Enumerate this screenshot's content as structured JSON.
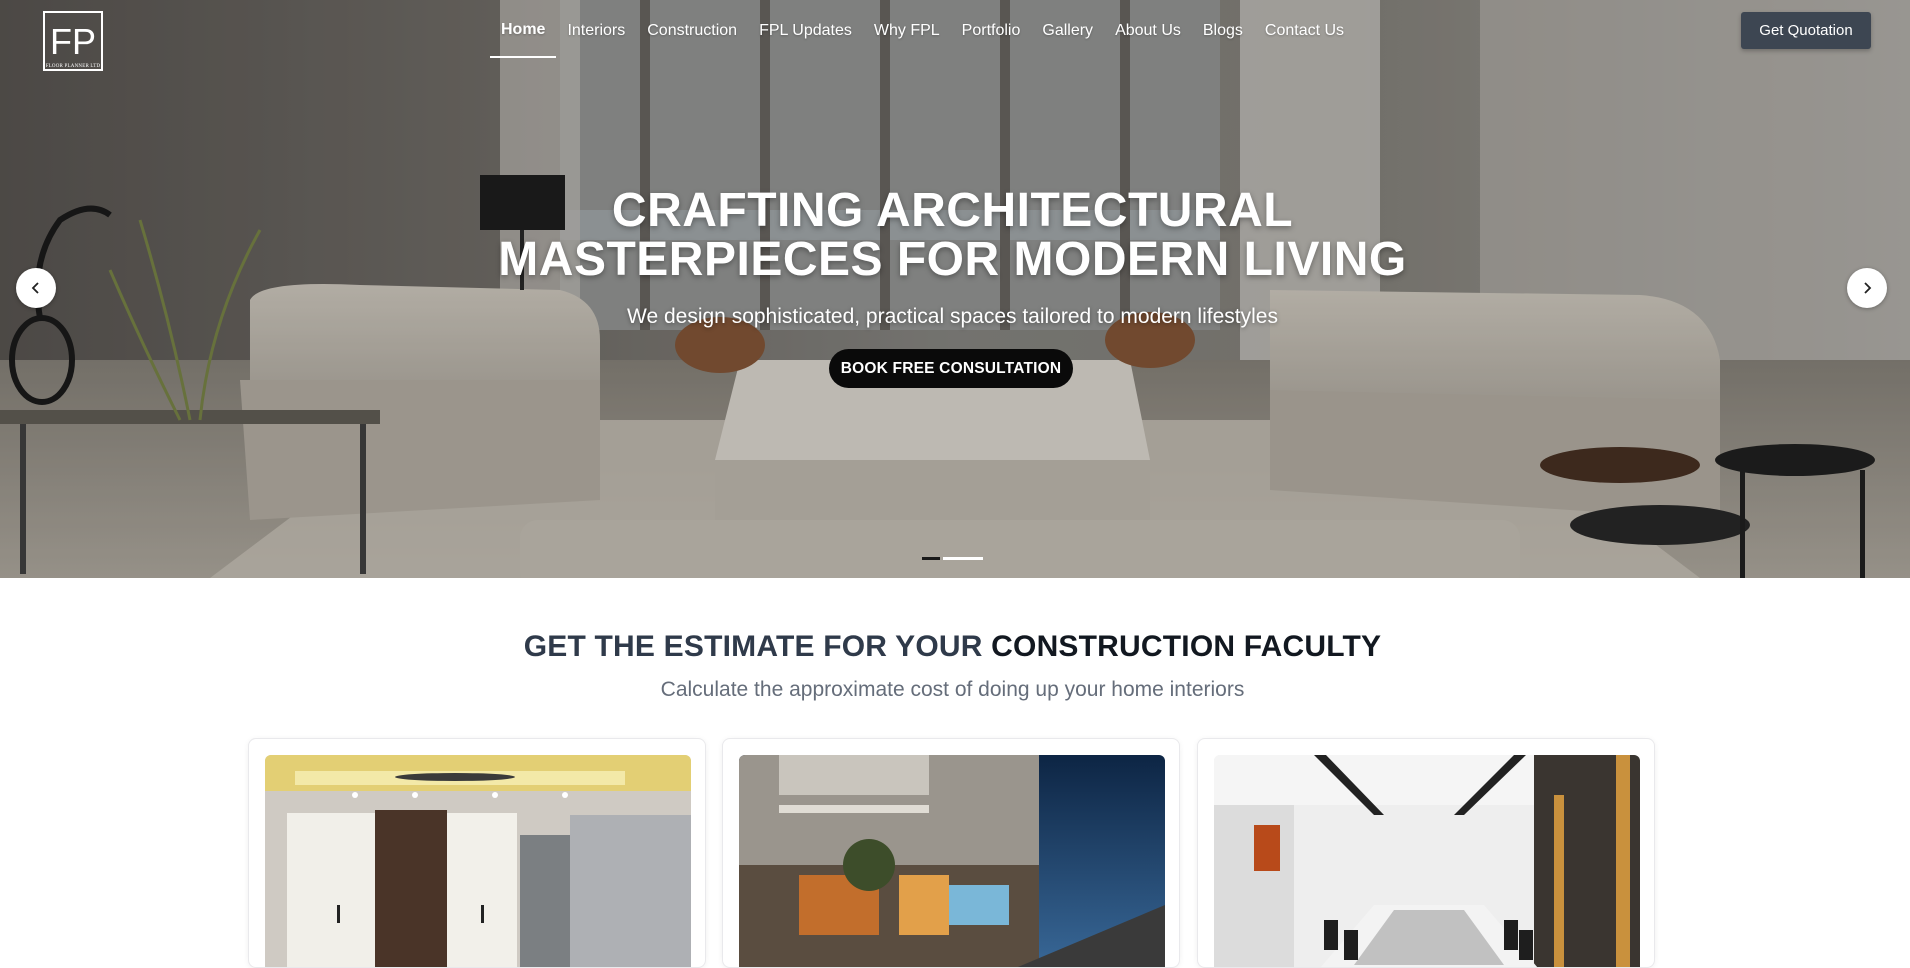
{
  "brand": {
    "logo_text": "FP",
    "logo_subtext": "FLOOR PLANNER LTD"
  },
  "nav": {
    "items": [
      {
        "label": "Home",
        "active": true
      },
      {
        "label": "Interiors"
      },
      {
        "label": "Construction"
      },
      {
        "label": "FPL Updates"
      },
      {
        "label": "Why FPL"
      },
      {
        "label": "Portfolio"
      },
      {
        "label": "Gallery"
      },
      {
        "label": "About Us"
      },
      {
        "label": "Blogs"
      },
      {
        "label": "Contact Us"
      }
    ],
    "quote_button": "Get Quotation"
  },
  "hero": {
    "title_line1": "CRAFTING ARCHITECTURAL",
    "title_line2": "MASTERPIECES FOR MODERN LIVING",
    "subtitle": "We design sophisticated, practical spaces tailored to modern lifestyles",
    "cta": "BOOK FREE CONSULTATION",
    "prev_icon": "chevron-left-icon",
    "next_icon": "chevron-right-icon",
    "slides_total": 2,
    "slide_active": 2
  },
  "estimate": {
    "title_part1": "GET THE ESTIMATE FOR YOUR ",
    "title_part2": "CONSTRUCTION FACULTY",
    "subtitle": "Calculate the approximate cost of doing up your home interiors",
    "cards": [
      {
        "image": "bedroom-wardrobe-interior"
      },
      {
        "image": "residential-building-exterior-night"
      },
      {
        "image": "conference-room-interior"
      }
    ]
  },
  "colors": {
    "quote_button_bg": "#3d4652",
    "cta_bg": "#0a0a0a",
    "title_blue": "#2f3a4a",
    "subtitle_gray": "#656d7a"
  }
}
